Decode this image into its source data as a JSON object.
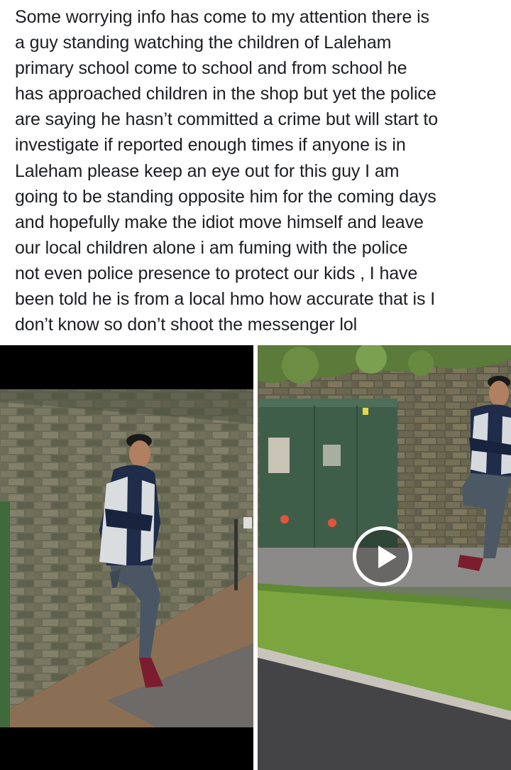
{
  "post": {
    "text": "Some worrying info has come to my attention there is\na guy standing watching the children of Laleham\nprimary school come to school and from school he\nhas approached children in the shop but yet the police\nare saying he hasn’t committed a crime but will start to\ninvestigate if reported enough times if anyone is in\nLaleham please keep an eye out for this guy I am\ngoing to be standing opposite him for the coming days\nand hopefully make the idiot move himself and leave\nour local children alone i am fuming with the police\nnot even police presence to protect our kids , I have\nbeen told he is from a local hmo how accurate that is I\ndon’t know so don’t shoot the messenger lol"
  },
  "media": [
    {
      "type": "photo"
    },
    {
      "type": "video",
      "control_icon": "play-icon"
    }
  ]
}
